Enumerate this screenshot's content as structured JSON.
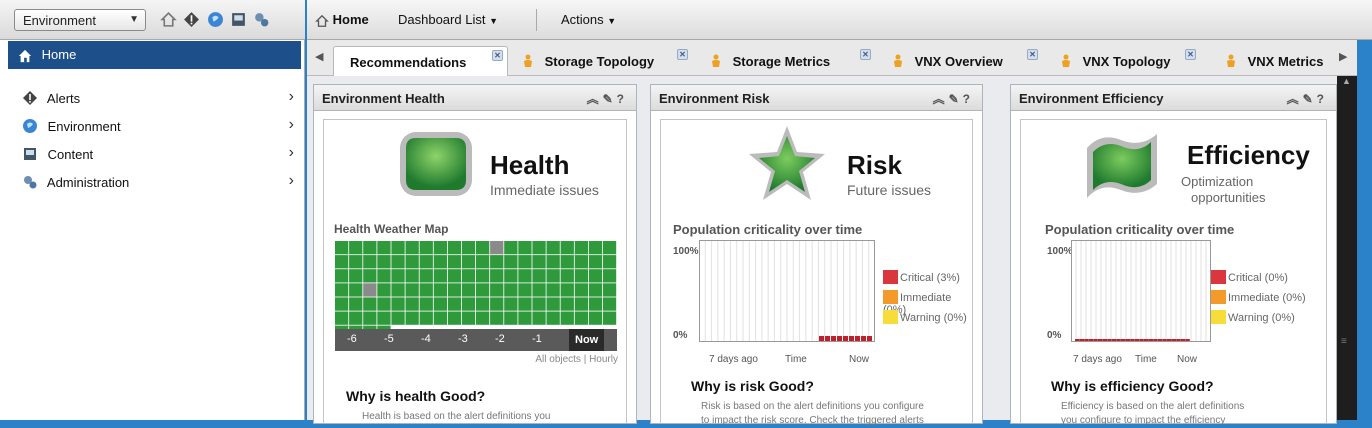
{
  "left_pane": {
    "environment_selector": "Environment",
    "home_label": "Home",
    "nav_items": [
      {
        "label": "Alerts"
      },
      {
        "label": "Environment"
      },
      {
        "label": "Content"
      },
      {
        "label": "Administration"
      }
    ]
  },
  "toolbar": {
    "home": "Home",
    "dashboard_list": "Dashboard List",
    "actions": "Actions"
  },
  "tabs": [
    {
      "label": "Recommendations",
      "active": true
    },
    {
      "label": "Storage Topology"
    },
    {
      "label": "Storage Metrics"
    },
    {
      "label": "VNX Overview"
    },
    {
      "label": "VNX Topology"
    },
    {
      "label": "VNX Metrics"
    }
  ],
  "widgets": {
    "health": {
      "header": "Environment Health",
      "title": "Health",
      "subtitle": "Immediate issues",
      "map_title": "Health Weather Map",
      "map_ticks": [
        "-6",
        "-5",
        "-4",
        "-3",
        "-2",
        "-1",
        "Now"
      ],
      "map_footer": "All objects | Hourly",
      "why": "Why is health Good?",
      "desc": "Health is based on the alert definitions you"
    },
    "risk": {
      "header": "Environment Risk",
      "title": "Risk",
      "subtitle": "Future issues",
      "chart_title": "Population criticality over time",
      "y_top": "100%",
      "y_bottom": "0%",
      "x_labels": [
        "7 days ago",
        "Time",
        "Now"
      ],
      "legend": [
        "Critical (3%)",
        "Immediate (0%)",
        "Warning (0%)"
      ],
      "why": "Why is risk Good?",
      "desc_line1": "Risk is based on the alert definitions you configure",
      "desc_line2": "to impact the risk score. Check the triggered alerts"
    },
    "efficiency": {
      "header": "Environment Efficiency",
      "title": "Efficiency",
      "subtitle_line1": "Optimization",
      "subtitle_line2": "opportunities",
      "chart_title": "Population criticality over time",
      "y_top": "100%",
      "y_bottom": "0%",
      "x_labels": [
        "7 days ago",
        "Time",
        "Now"
      ],
      "legend": [
        "Critical (0%)",
        "Immediate (0%)",
        "Warning (0%)"
      ],
      "why": "Why is efficiency Good?",
      "desc_line1": "Efficiency is based on the alert definitions",
      "desc_line2": "you configure to impact the efficiency"
    }
  },
  "colors": {
    "nav_selected": "#1d4f8a",
    "healthy_green": "#2e9a3c",
    "critical": "#d9363e",
    "immediate": "#f49a2a",
    "warning": "#f7dc3a",
    "timeline_bg": "#5a5a5a"
  },
  "icons": {
    "nav": [
      "alert-icon",
      "environment-icon",
      "content-icon",
      "administration-icon"
    ]
  }
}
